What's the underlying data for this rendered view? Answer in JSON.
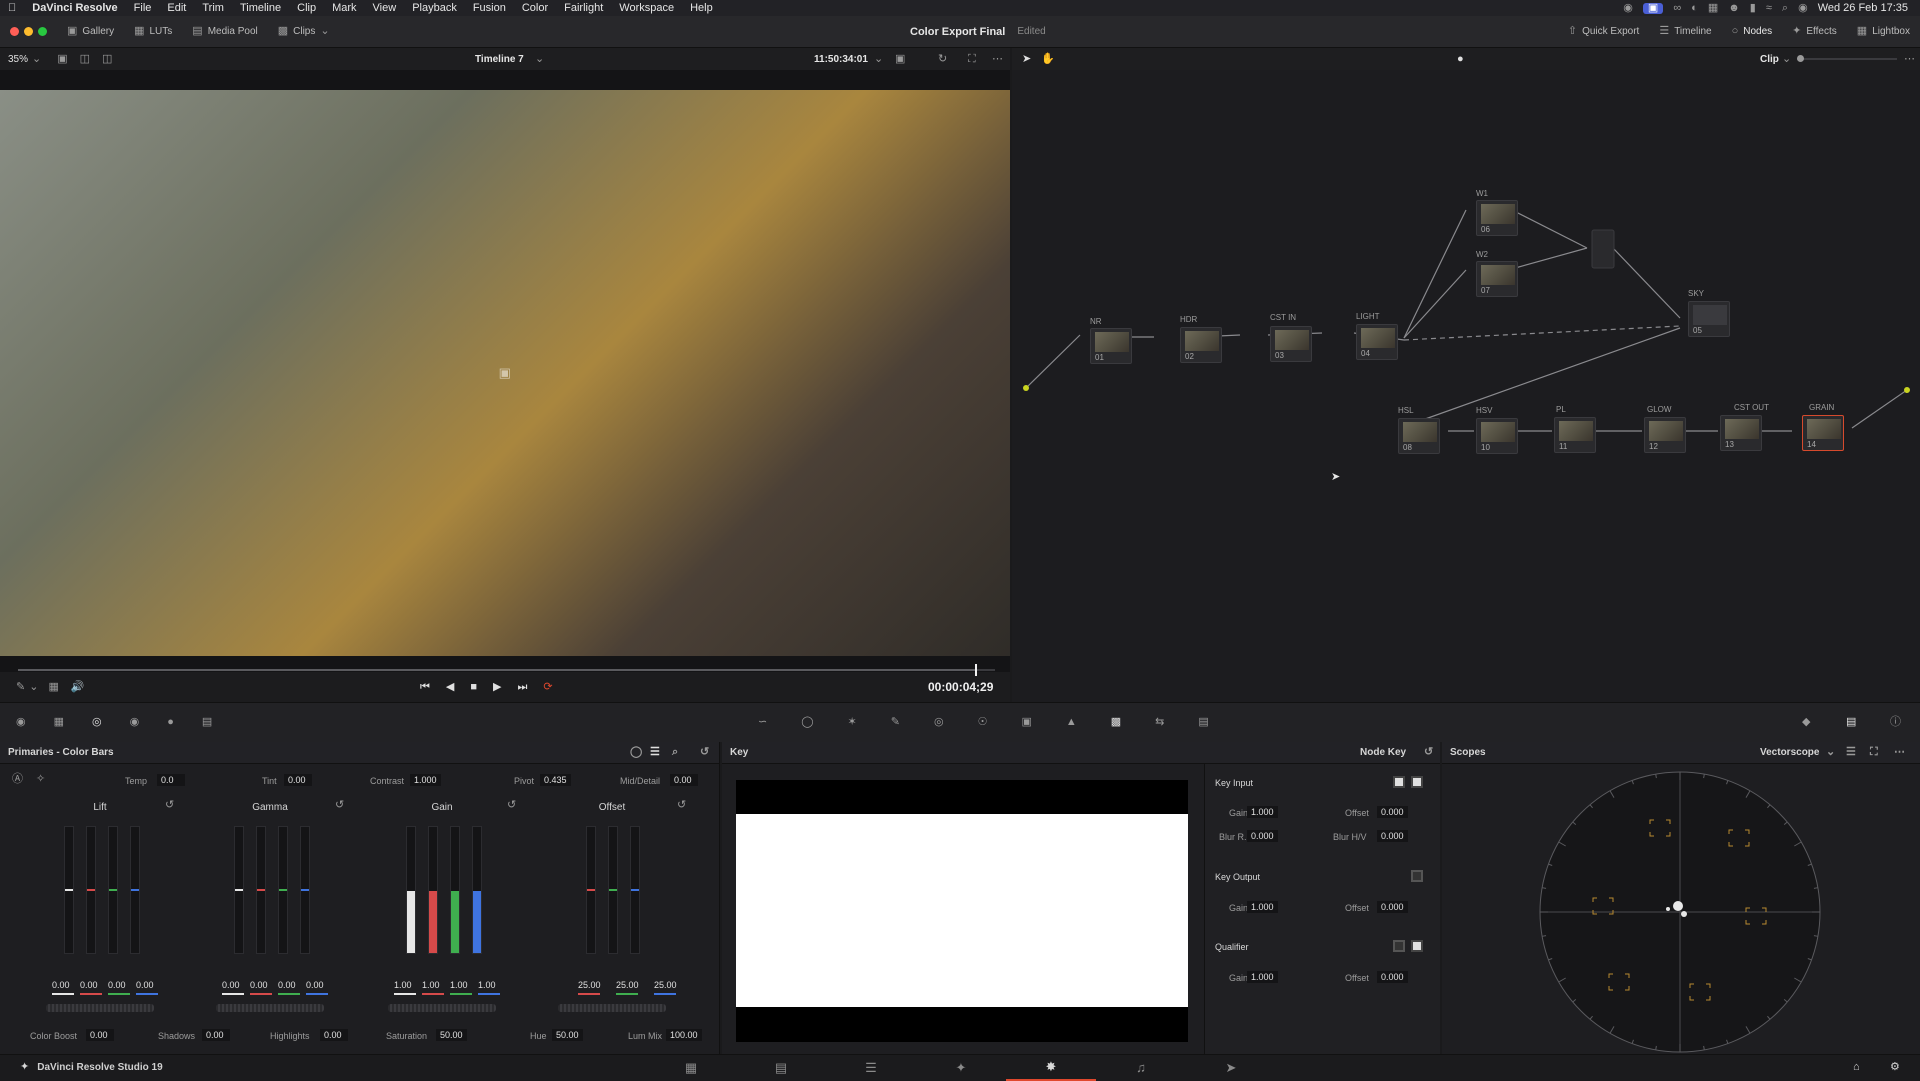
{
  "menubar": {
    "app": "DaVinci Resolve",
    "items": [
      "File",
      "Edit",
      "Trim",
      "Timeline",
      "Clip",
      "Mark",
      "View",
      "Playback",
      "Fusion",
      "Color",
      "Fairlight",
      "Workspace",
      "Help"
    ],
    "datetime": "Wed 26 Feb  17:35"
  },
  "toolbar": {
    "gallery": "Gallery",
    "luts": "LUTs",
    "media_pool": "Media Pool",
    "clips": "Clips",
    "project_title": "Color Export Final",
    "status": "Edited",
    "quick_export": "Quick Export",
    "timeline": "Timeline",
    "nodes": "Nodes",
    "effects": "Effects",
    "lightbox": "Lightbox"
  },
  "viewer": {
    "zoom": "35%",
    "timeline_name": "Timeline 7",
    "source_timecode": "11:50:34:01",
    "playhead_timecode": "00:00:04;29",
    "scrubber_progress": 0.98
  },
  "nodegraph": {
    "mode": "Clip",
    "nodes": [
      {
        "label": "NR",
        "num": "01"
      },
      {
        "label": "HDR",
        "num": "02"
      },
      {
        "label": "CST IN",
        "num": "03"
      },
      {
        "label": "LIGHT",
        "num": "04"
      },
      {
        "label": "W1",
        "num": "06"
      },
      {
        "label": "W2",
        "num": "07"
      },
      {
        "label": "SKY",
        "num": "05"
      },
      {
        "label": "HSL",
        "num": "08"
      },
      {
        "label": "HSV",
        "num": "10"
      },
      {
        "label": "PL",
        "num": "11"
      },
      {
        "label": "GLOW",
        "num": "12"
      },
      {
        "label": "CST OUT",
        "num": "13"
      },
      {
        "label": "GRAIN",
        "num": "14"
      }
    ]
  },
  "primaries": {
    "title": "Primaries - Color Bars",
    "temp_label": "Temp",
    "temp": "0.0",
    "tint_label": "Tint",
    "tint": "0.00",
    "contrast_label": "Contrast",
    "contrast": "1.000",
    "pivot_label": "Pivot",
    "pivot": "0.435",
    "middetail_label": "Mid/Detail",
    "middetail": "0.00",
    "wheels": [
      {
        "name": "Lift",
        "values": [
          "0.00",
          "0.00",
          "0.00",
          "0.00"
        ]
      },
      {
        "name": "Gamma",
        "values": [
          "0.00",
          "0.00",
          "0.00",
          "0.00"
        ]
      },
      {
        "name": "Gain",
        "values": [
          "1.00",
          "1.00",
          "1.00",
          "1.00"
        ]
      },
      {
        "name": "Offset",
        "values": [
          "25.00",
          "25.00",
          "25.00"
        ]
      }
    ],
    "colorboost_label": "Color Boost",
    "colorboost": "0.00",
    "shadows_label": "Shadows",
    "shadows": "0.00",
    "highlights_label": "Highlights",
    "highlights": "0.00",
    "saturation_label": "Saturation",
    "saturation": "50.00",
    "hue_label": "Hue",
    "hue": "50.00",
    "lummix_label": "Lum Mix",
    "lummix": "100.00"
  },
  "key": {
    "title": "Key",
    "node_key": "Node Key",
    "key_input": "Key Input",
    "key_output": "Key Output",
    "qualifier": "Qualifier",
    "gain_label": "Gain",
    "offset_label": "Offset",
    "blur_r_label": "Blur R.",
    "blur_hv_label": "Blur H/V",
    "in_gain": "1.000",
    "in_offset": "0.000",
    "in_blur_r": "0.000",
    "in_blur_hv": "0.000",
    "out_gain": "1.000",
    "out_offset": "0.000",
    "q_gain": "1.000",
    "q_offset": "0.000"
  },
  "scopes": {
    "title": "Scopes",
    "type": "Vectorscope"
  },
  "bottombar": {
    "product": "DaVinci Resolve Studio 19"
  },
  "colors": {
    "accent": "#e0482d",
    "node_in": "#c9d420",
    "node_key": "#4a8fe6",
    "lift_red": "#c0392b",
    "lift_green": "#27ae60",
    "lift_blue": "#2f6fd6"
  }
}
